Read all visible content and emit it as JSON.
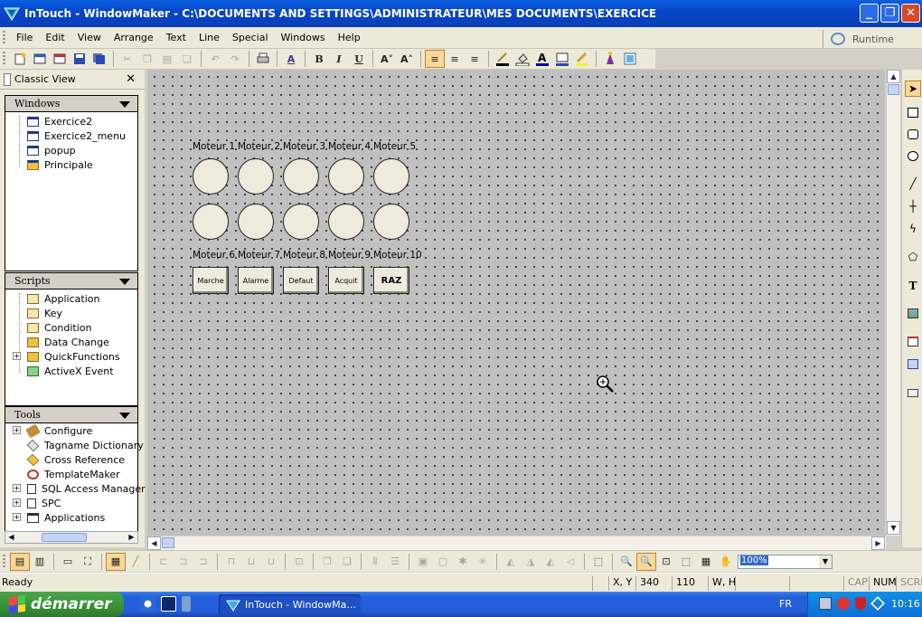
{
  "window": {
    "title": "InTouch - WindowMaker - C:\\DOCUMENTS AND SETTINGS\\ADMINISTRATEUR\\MES DOCUMENTS\\EXERCICE",
    "btn_min": "_",
    "btn_max": "❐",
    "btn_close": "✕"
  },
  "menu": [
    "File",
    "Edit",
    "View",
    "Arrange",
    "Text",
    "Line",
    "Special",
    "Windows",
    "Help"
  ],
  "runtime_label": "Runtime",
  "classic_view": {
    "title": "Classic View",
    "close": "✕",
    "windows": {
      "header": "Windows",
      "items": [
        "Exercice2",
        "Exercice2_menu",
        "popup",
        "Principale"
      ]
    },
    "scripts": {
      "header": "Scripts",
      "items": [
        "Application",
        "Key",
        "Condition",
        "Data Change",
        "QuickFunctions",
        "ActiveX Event"
      ]
    },
    "tools": {
      "header": "Tools",
      "items": [
        "Configure",
        "Tagname Dictionary",
        "Cross Reference",
        "TemplateMaker",
        "SQL Access Manager",
        "SPC",
        "Applications"
      ]
    }
  },
  "canvas": {
    "motors_top": [
      "Moteur 1",
      "Moteur 2",
      "Moteur 3",
      "Moteur 4",
      "Moteur 5"
    ],
    "motors_bottom": [
      "Moteur 6",
      "Moteur 7",
      "Moteur 8",
      "Moteur 9",
      "Moteur 10"
    ],
    "buttons": [
      "Marche",
      "Alarme",
      "Defaut",
      "Acquit",
      "RAZ"
    ]
  },
  "zoom": "100%",
  "status": {
    "ready": "Ready",
    "xy_label": "X, Y",
    "x_value": "340",
    "y_value": "110",
    "wh_label": "W, H",
    "cap": "CAP",
    "num": "NUM",
    "scrl": "SCRL"
  },
  "taskbar": {
    "start": "démarrer",
    "task": "InTouch - WindowMa...",
    "lang": "FR",
    "clock": "10:16"
  },
  "colors": {
    "titlebar": "#0a5fe0",
    "canvas": "#c0c0c0",
    "object_fill": "#efebdc",
    "taskbar": "#245edb",
    "start": "#3c943c"
  }
}
